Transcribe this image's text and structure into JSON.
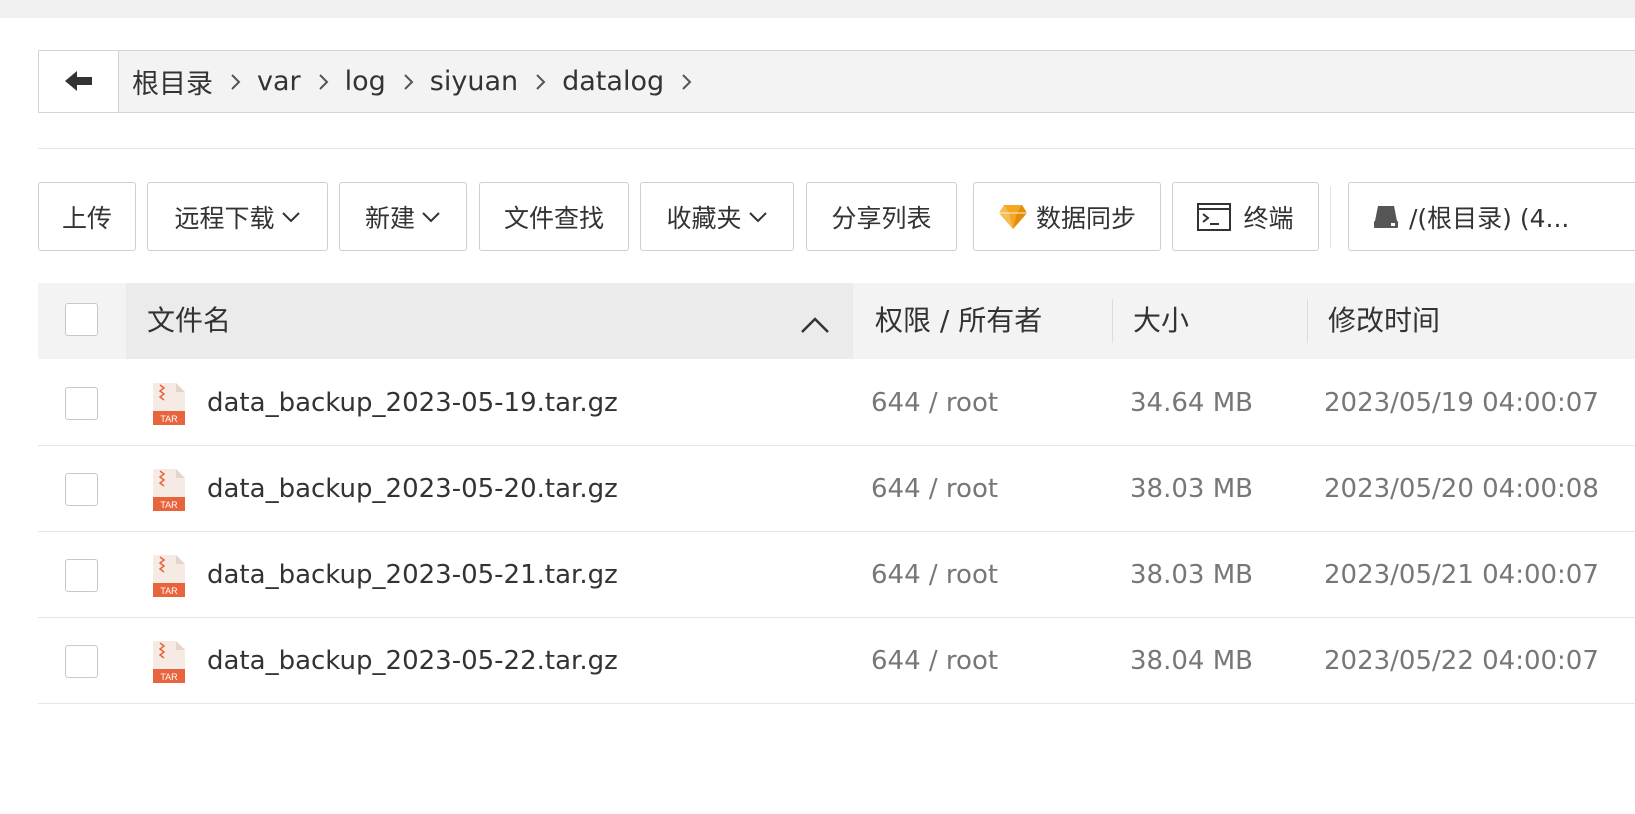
{
  "breadcrumb": {
    "items": [
      "根目录",
      "var",
      "log",
      "siyuan",
      "datalog"
    ]
  },
  "toolbar": {
    "upload": "上传",
    "remote_download": "远程下载",
    "new": "新建",
    "file_search": "文件查找",
    "favorites": "收藏夹",
    "share_list": "分享列表",
    "data_sync": "数据同步",
    "terminal": "终端",
    "disk": "/(根目录) (4..."
  },
  "table": {
    "headers": {
      "name": "文件名",
      "perm_owner": "权限 / 所有者",
      "size": "大小",
      "mtime": "修改时间"
    },
    "rows": [
      {
        "name": "data_backup_2023-05-19.tar.gz",
        "perm": "644 / root",
        "size": "34.64 MB",
        "mtime": "2023/05/19 04:00:07"
      },
      {
        "name": "data_backup_2023-05-20.tar.gz",
        "perm": "644 / root",
        "size": "38.03 MB",
        "mtime": "2023/05/20 04:00:08"
      },
      {
        "name": "data_backup_2023-05-21.tar.gz",
        "perm": "644 / root",
        "size": "38.03 MB",
        "mtime": "2023/05/21 04:00:07"
      },
      {
        "name": "data_backup_2023-05-22.tar.gz",
        "perm": "644 / root",
        "size": "38.04 MB",
        "mtime": "2023/05/22 04:00:07"
      }
    ],
    "file_icon_label": "TAR"
  },
  "colors": {
    "accent_orange": "#e8643c",
    "gem_orange": "#f5a623"
  }
}
